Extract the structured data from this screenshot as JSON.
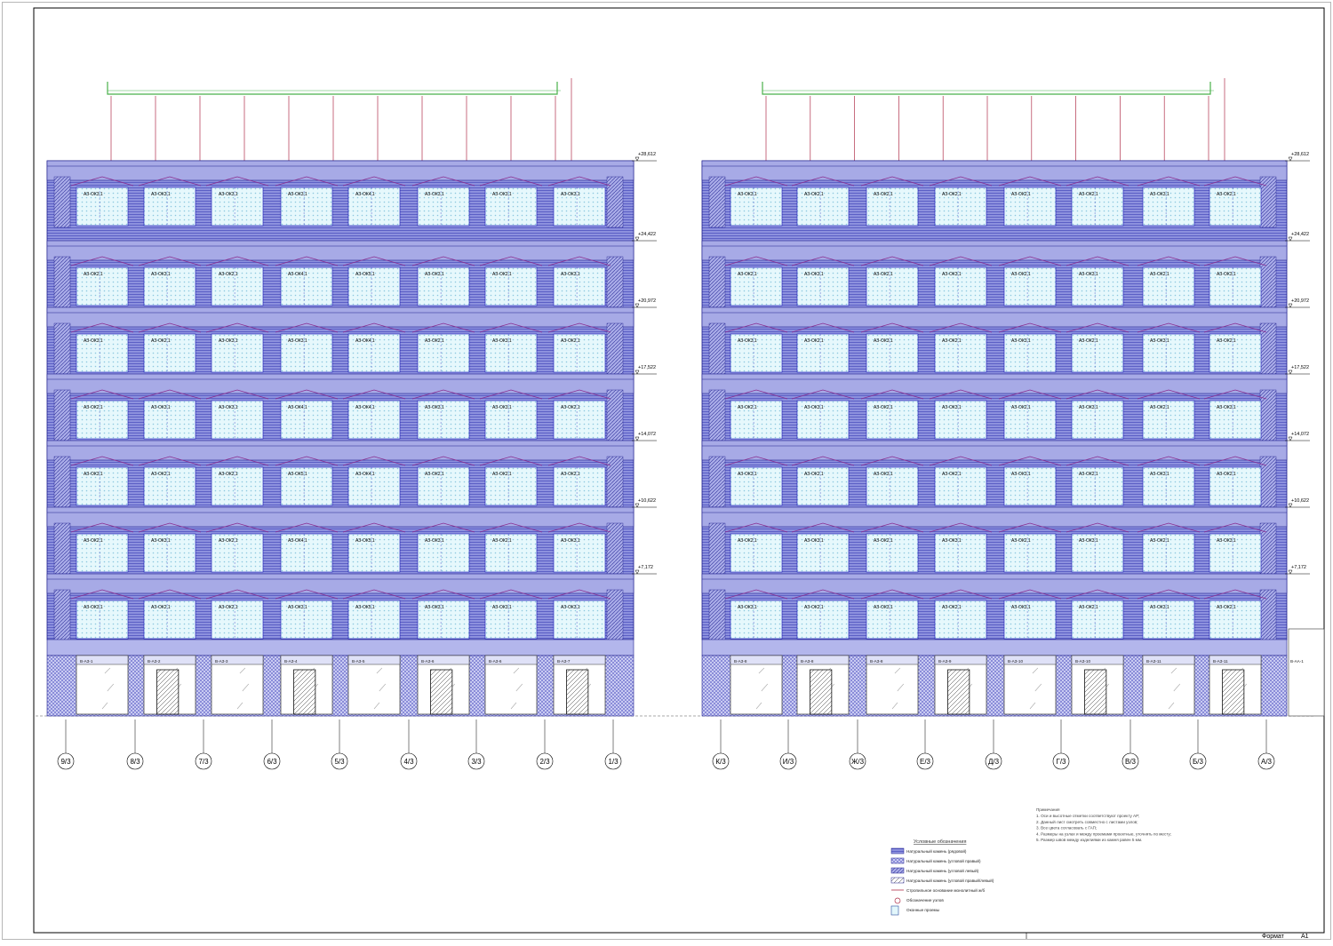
{
  "left": {
    "levels": [
      "+28,612",
      "+24,422",
      "+20,972",
      "+17,522",
      "+14,072",
      "+10,622",
      "+7,172"
    ],
    "rows": [
      [
        "АЗ-ОК3.1",
        "АЗ-ОК3.1",
        "АЗ-ОК3.1",
        "АЗ-ОК3.1",
        "АЗ-ОК4.1",
        "АЗ-ОК3.1",
        "АЗ-ОК3.1",
        "АЗ-ОК3.1"
      ],
      [
        "АЗ-ОК2.1",
        "АЗ-ОК3.1",
        "АЗ-ОК2.1",
        "АЗ-ОК4.1",
        "АЗ-ОК5.1",
        "АЗ-ОК3.1",
        "АЗ-ОК2.1",
        "АЗ-ОК3.1"
      ],
      [
        "АЗ-ОК3.1",
        "АЗ-ОК2.1",
        "АЗ-ОК3.1",
        "АЗ-ОК3.1",
        "АЗ-ОК4.1",
        "АЗ-ОК2.1",
        "АЗ-ОК3.1",
        "АЗ-ОК2.1"
      ],
      [
        "АЗ-ОК2.1",
        "АЗ-ОК3.1",
        "АЗ-ОК3.1",
        "АЗ-ОК4.1",
        "АЗ-ОК4.1",
        "АЗ-ОК3.1",
        "АЗ-ОК3.1",
        "АЗ-ОК2.1"
      ],
      [
        "АЗ-ОК3.1",
        "АЗ-ОК2.1",
        "АЗ-ОК2.1",
        "АЗ-ОК5.1",
        "АЗ-ОК4.1",
        "АЗ-ОК2.1",
        "АЗ-ОК2.1",
        "АЗ-ОК2.1"
      ],
      [
        "АЗ-ОК2.1",
        "АЗ-ОК3.1",
        "АЗ-ОК2.1",
        "АЗ-ОК4.1",
        "АЗ-ОК5.1",
        "АЗ-ОК3.1",
        "АЗ-ОК2.1",
        "АЗ-ОК3.1"
      ],
      [
        "АЗ-ОК3.1",
        "АЗ-ОК2.1",
        "АЗ-ОК2.1",
        "АЗ-ОК3.1",
        "АЗ-ОК5.1",
        "АЗ-ОК3.1",
        "АЗ-ОК3.1",
        "АЗ-ОК3.1"
      ]
    ],
    "ground": [
      "В-АЗ-1",
      "В-АЗ-2",
      "В-АЗ-3",
      "В-АЗ-4",
      "В-АЗ-5",
      "В-АЗ-6",
      "В-АЗ-6",
      "В-АЗ-7"
    ],
    "axes": [
      "9/3",
      "8/3",
      "7/3",
      "6/3",
      "5/3",
      "4/3",
      "3/3",
      "2/3",
      "1/3"
    ]
  },
  "right": {
    "levels": [
      "+28,612",
      "+24,422",
      "+20,972",
      "+17,522",
      "+14,072",
      "+10,622",
      "+7,172"
    ],
    "rows": [
      [
        "АЗ-ОК3.1",
        "АЗ-ОК2.1",
        "АЗ-ОК2.1",
        "АЗ-ОК2.1",
        "АЗ-ОК2.1",
        "АЗ-ОК2.1",
        "АЗ-ОК3.1",
        "АЗ-ОК2.1"
      ],
      [
        "АЗ-ОК2.1",
        "АЗ-ОК3.1",
        "АЗ-ОК2.1",
        "АЗ-ОК3.1",
        "АЗ-ОК2.1",
        "АЗ-ОК3.1",
        "АЗ-ОК2.1",
        "АЗ-ОК3.1"
      ],
      [
        "АЗ-ОК3.1",
        "АЗ-ОК2.1",
        "АЗ-ОК3.1",
        "АЗ-ОК2.1",
        "АЗ-ОК3.1",
        "АЗ-ОК2.1",
        "АЗ-ОК3.1",
        "АЗ-ОК2.1"
      ],
      [
        "АЗ-ОК2.1",
        "АЗ-ОК3.1",
        "АЗ-ОК2.1",
        "АЗ-ОК3.1",
        "АЗ-ОК2.1",
        "АЗ-ОК3.1",
        "АЗ-ОК2.1",
        "АЗ-ОК3.1"
      ],
      [
        "АЗ-ОК3.1",
        "АЗ-ОК2.1",
        "АЗ-ОК3.1",
        "АЗ-ОК2.1",
        "АЗ-ОК3.1",
        "АЗ-ОК2.1",
        "АЗ-ОК3.1",
        "АЗ-ОК2.1"
      ],
      [
        "АЗ-ОК2.1",
        "АЗ-ОК3.1",
        "АЗ-ОК2.1",
        "АЗ-ОК3.1",
        "АЗ-ОК2.1",
        "АЗ-ОК3.1",
        "АЗ-ОК2.1",
        "АЗ-ОК3.1"
      ],
      [
        "АЗ-ОК3.1",
        "АЗ-ОК2.1",
        "АЗ-ОК3.1",
        "АЗ-ОК2.1",
        "АЗ-ОК3.1",
        "АЗ-ОК2.1",
        "АЗ-ОК3.1",
        "АЗ-ОК2.1"
      ]
    ],
    "ground": [
      "В-АЗ-8",
      "В-АЗ-8",
      "В-АЗ-8",
      "В-АЗ-9",
      "В-АЗ-10",
      "В-АЗ-10",
      "В-АЗ-11",
      "В-АЗ-11"
    ],
    "extra_ground": "В-АА-1",
    "axes": [
      "К/3",
      "И/3",
      "Ж/3",
      "Е/3",
      "Д/3",
      "Г/3",
      "В/3",
      "Б/3",
      "А/3"
    ]
  },
  "legend": {
    "title": "Условные обозначения",
    "items": [
      "Натуральный камень (рядовой)",
      "Натуральный камень (угловой правый)",
      "Натуральный камень (угловой левый)",
      "Натуральный камень (угловой правый/левый)",
      "Стропильное основание монолитный ж/б",
      "Обозначение узлов",
      "Оконные проемы"
    ]
  },
  "notes": {
    "title": "Примечания",
    "lines": [
      "1. Оси и высотные отметки соответствуют проекту АР;",
      "2. Данный лист смотреть совместно с листами узлов;",
      "3. Все цвета согласовать с ГАП;",
      "4. Размеры на узлах и между проемами проектные, уточнять по месту;",
      "5. Размер швов между изделиями из камня равен 5 мм."
    ]
  },
  "stamp": {
    "format_label": "Формат",
    "format_value": "А1"
  },
  "colors": {
    "frame": "#000000",
    "stone": "#7b7fd6",
    "stone_light": "#b9bdf0",
    "window": "#e3f7fb",
    "window_dot": "#9fd3e6",
    "mullion": "#1a1ab8",
    "rebar": "#b0304a",
    "parapet": "#49b04a",
    "diag": "#8a2d8f"
  }
}
